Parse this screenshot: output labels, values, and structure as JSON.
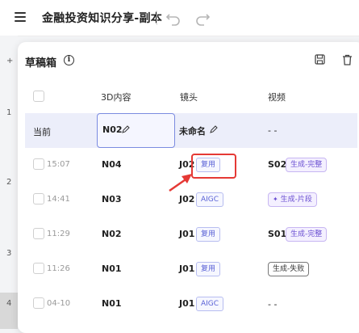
{
  "header": {
    "title": "金融投资知识分享-副本"
  },
  "sidebar_numbers": [
    "1",
    "2",
    "3",
    "4"
  ],
  "panel": {
    "title": "草稿箱",
    "columns": {
      "content": "3D内容",
      "shot": "镜头",
      "video": "视频"
    },
    "current_row": {
      "label": "当前",
      "content": "N02",
      "shot": "未命名",
      "video": "- -"
    },
    "rows": [
      {
        "time": "15:07",
        "content": "N04",
        "shot": "J02",
        "shot_tag": "复用",
        "video_code": "S02",
        "status": "生成-完整"
      },
      {
        "time": "14:41",
        "content": "N03",
        "shot": "J02",
        "shot_tag": "AIGC",
        "video_code": "",
        "status": "生成-片段"
      },
      {
        "time": "11:29",
        "content": "N02",
        "shot": "J01",
        "shot_tag": "复用",
        "video_code": "S01",
        "status": "生成-完整"
      },
      {
        "time": "11:26",
        "content": "N01",
        "shot": "J01",
        "shot_tag": "复用",
        "video_code": "",
        "status": "生成-失败"
      },
      {
        "time": "04-10",
        "content": "N01",
        "shot": "J01",
        "shot_tag": "AIGC",
        "video_code": "- -",
        "status": ""
      }
    ]
  },
  "colors": {
    "accent": "#5a62d6",
    "highlight": "#e53935",
    "current_row_bg": "#eceefa"
  }
}
